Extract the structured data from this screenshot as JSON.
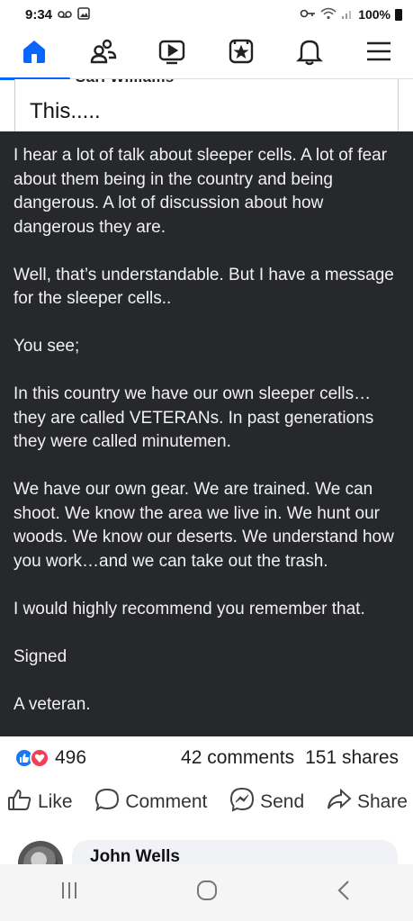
{
  "status_bar": {
    "time": "9:34",
    "battery": "100%",
    "left_icons": [
      "voicemail-icon",
      "gallery-icon"
    ],
    "right_icons": [
      "key-icon",
      "wifi-icon",
      "signal-icon",
      "battery-icon"
    ]
  },
  "nav": {
    "items": [
      {
        "name": "home",
        "icon": "home-icon",
        "active": true
      },
      {
        "name": "friends",
        "icon": "friends-icon",
        "active": false
      },
      {
        "name": "video",
        "icon": "video-icon",
        "active": false
      },
      {
        "name": "marketplace",
        "icon": "star-bag-icon",
        "active": false
      },
      {
        "name": "notifications",
        "icon": "bell-icon",
        "active": false
      },
      {
        "name": "menu",
        "icon": "hamburger-icon",
        "active": false
      }
    ],
    "accent": "#0866ff"
  },
  "quoted_post": {
    "author": "Carl Williams",
    "text": "This....."
  },
  "post_body": {
    "paragraphs": [
      "I hear a lot of talk about sleeper cells. A lot of fear about them being in the country and being dangerous. A lot of discussion about how dangerous they are.",
      "Well, that’s understandable. But I have a message for the sleeper cells..",
      "You see;",
      "In this country we have our own sleeper cells… they are called VETERANs. In past generations they were called minutemen.",
      "We have our own gear. We are trained. We can shoot. We know the area we live in. We hunt our woods. We know our deserts. We understand how you work…and we can take out the trash.",
      "I would highly recommend you remember that.",
      "Signed",
      "A veteran."
    ],
    "background": "#27282b"
  },
  "stats": {
    "reaction_count": "496",
    "comments": "42 comments",
    "shares": "151 shares"
  },
  "actions": {
    "like": "Like",
    "comment": "Comment",
    "send": "Send",
    "share": "Share"
  },
  "comment_preview": {
    "name": "John Wells"
  }
}
